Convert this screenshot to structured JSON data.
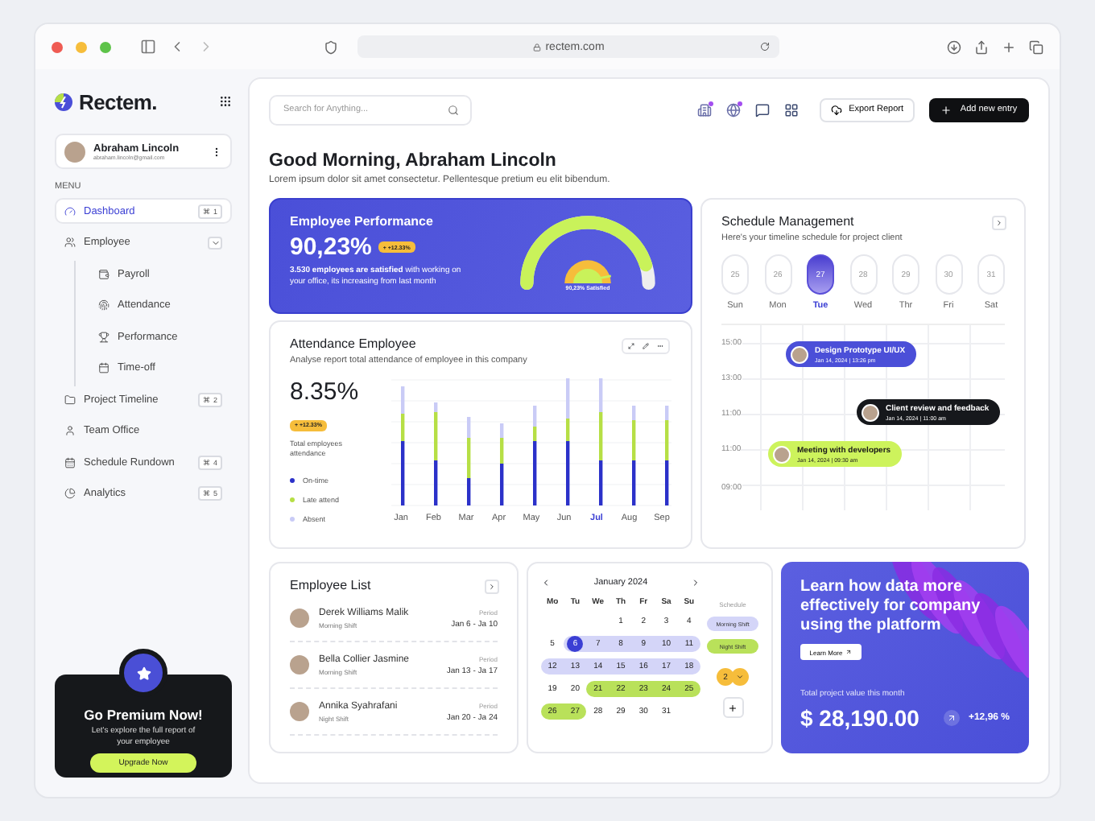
{
  "browser": {
    "url": "rectem.com"
  },
  "sidebar": {
    "logo": "Rectem.",
    "user": {
      "name": "Abraham Lincoln",
      "email": "abraham.lincoln@gmail.com"
    },
    "menu_label": "MENU",
    "items": [
      {
        "label": "Dashboard",
        "kind": "dashboard",
        "shortcut": "⌘ 1",
        "selected": true
      },
      {
        "label": "Employee",
        "kind": "employee",
        "selected": false,
        "expanded": true,
        "children": [
          {
            "label": "Payroll",
            "kind": "payroll"
          },
          {
            "label": "Attendance",
            "kind": "attendance"
          },
          {
            "label": "Performance",
            "kind": "performance"
          },
          {
            "label": "Time-off",
            "kind": "timeoff"
          }
        ]
      },
      {
        "label": "Project Timeline",
        "kind": "project",
        "shortcut": "⌘ 2",
        "selected": false
      },
      {
        "label": "Team Office",
        "kind": "team",
        "selected": false
      },
      {
        "label": "Schedule Rundown",
        "kind": "schedule",
        "shortcut": "⌘ 4",
        "selected": false
      },
      {
        "label": "Analytics",
        "kind": "analytics",
        "shortcut": "⌘ 5",
        "selected": false
      }
    ],
    "premium": {
      "title": "Go Premium Now!",
      "text": "Let's explore the full report of your employee",
      "button": "Upgrade Now"
    }
  },
  "header": {
    "search": {
      "placeholder": "Search for Anything..."
    },
    "export": "Export Report",
    "add": "Add new entry"
  },
  "greeting": {
    "title": "Good Morning, Abraham Lincoln",
    "subtitle": "Lorem ipsum dolor sit amet consectetur. Pellentesque pretium eu elit bibendum."
  },
  "performance": {
    "title": "Employee Performance",
    "value": "90,23%",
    "badge": "+ +12.33%",
    "text": "**3.530 employees are satisfied** with working on your office, its increasing from last month",
    "gauge": {
      "level": 0.9023,
      "label": "90,23% Satisfied"
    }
  },
  "attendance": {
    "title": "Attendance Employee",
    "subtitle": "Analyse report total attendance of employee in this company",
    "value": "8.35%",
    "badge": "+ +12.33%",
    "caption": "Total employees attendance",
    "legend": [
      {
        "label": "On-time",
        "color": "#2b31c9"
      },
      {
        "label": "Late attend",
        "color": "#b6df45"
      },
      {
        "label": "Absent",
        "color": "#c9cbf6"
      }
    ],
    "months": [
      {
        "label": "Jan",
        "selected": false
      },
      {
        "label": "Feb",
        "selected": false
      },
      {
        "label": "Mar",
        "selected": false
      },
      {
        "label": "Apr",
        "selected": false
      },
      {
        "label": "May",
        "selected": false
      },
      {
        "label": "Jun",
        "selected": false
      },
      {
        "label": "Jul",
        "selected": true
      },
      {
        "label": "Aug",
        "selected": false
      },
      {
        "label": "Sep",
        "selected": false
      }
    ]
  },
  "schedule": {
    "title": "Schedule Management",
    "subtitle": "Here's your timeline schedule for project client",
    "days": [
      {
        "date": "25",
        "weekday": "Sun",
        "selected": false
      },
      {
        "date": "26",
        "weekday": "Mon",
        "selected": false
      },
      {
        "date": "27",
        "weekday": "Tue",
        "selected": true
      },
      {
        "date": "28",
        "weekday": "Wed",
        "selected": false
      },
      {
        "date": "29",
        "weekday": "Thr",
        "selected": false
      },
      {
        "date": "30",
        "weekday": "Fri",
        "selected": false
      },
      {
        "date": "31",
        "weekday": "Sat",
        "selected": false
      }
    ],
    "times": [
      "15:00",
      "13:00",
      "11:00",
      "11:00",
      "09:00"
    ],
    "events": [
      {
        "title": "Design Prototype UI/UX",
        "time": "Jan 14, 2024 | 13:26 pm",
        "color": "#4b4fd8"
      },
      {
        "title": "Client review and feedback",
        "time": "Jan 14, 2024 | 11:00 am",
        "color": "#16181c"
      },
      {
        "title": "Meeting with developers",
        "time": "Jan 14, 2024 | 09:30 am",
        "color": "#cdf35c"
      }
    ]
  },
  "employees": {
    "title": "Employee List",
    "rows": [
      {
        "name": "Derek Williams Malik",
        "shift": "Morning Shift",
        "period_label": "Period",
        "period": "Jan 6 - Ja 10"
      },
      {
        "name": "Bella Collier Jasmine",
        "shift": "Morning Shift",
        "period_label": "Period",
        "period": "Jan 13 - Ja 17"
      },
      {
        "name": "Annika Syahrafani",
        "shift": "Night Shift",
        "period_label": "Period",
        "period": "Jan 20 - Ja 24"
      }
    ]
  },
  "calendar": {
    "month": "January 2024",
    "weekdays": [
      "Mo",
      "Tu",
      "We",
      "Th",
      "Fr",
      "Sa",
      "Su"
    ],
    "weeks": [
      [
        {
          "day": "1",
          "kind": "plain",
          "selected": false
        },
        {
          "day": "2",
          "kind": "plain",
          "selected": false
        },
        {
          "day": "3",
          "kind": "plain",
          "selected": false
        },
        {
          "day": "4",
          "kind": "plain",
          "selected": false
        }
      ],
      [
        {
          "day": "5",
          "kind": "plain",
          "selected": false
        },
        {
          "day": "6",
          "kind": "morning",
          "selected": true
        },
        {
          "day": "7",
          "kind": "morning",
          "selected": false
        },
        {
          "day": "8",
          "kind": "morning",
          "selected": false
        },
        {
          "day": "9",
          "kind": "morning",
          "selected": false
        },
        {
          "day": "10",
          "kind": "morning",
          "selected": false
        },
        {
          "day": "11",
          "kind": "morning",
          "selected": false
        }
      ],
      [
        {
          "day": "12",
          "kind": "morning",
          "selected": false
        },
        {
          "day": "13",
          "kind": "morning",
          "selected": false
        },
        {
          "day": "14",
          "kind": "morning",
          "selected": false
        },
        {
          "day": "15",
          "kind": "morning",
          "selected": false
        },
        {
          "day": "16",
          "kind": "morning",
          "selected": false
        },
        {
          "day": "17",
          "kind": "morning",
          "selected": false
        },
        {
          "day": "18",
          "kind": "morning",
          "selected": false
        }
      ],
      [
        {
          "day": "19",
          "kind": "plain",
          "selected": false
        },
        {
          "day": "20",
          "kind": "plain",
          "selected": false
        },
        {
          "day": "21",
          "kind": "night",
          "selected": false
        },
        {
          "day": "22",
          "kind": "night",
          "selected": false
        },
        {
          "day": "23",
          "kind": "night",
          "selected": false
        },
        {
          "day": "24",
          "kind": "night",
          "selected": false
        },
        {
          "day": "25",
          "kind": "night",
          "selected": false
        }
      ],
      [
        {
          "day": "26",
          "kind": "night",
          "selected": false
        },
        {
          "day": "27",
          "kind": "night",
          "selected": false
        },
        {
          "day": "28",
          "kind": "plain",
          "selected": false
        },
        {
          "day": "29",
          "kind": "plain",
          "selected": false
        },
        {
          "day": "30",
          "kind": "plain",
          "selected": false
        },
        {
          "day": "31",
          "kind": "plain",
          "selected": false
        }
      ]
    ],
    "legend_title": "Schedule",
    "legend": [
      {
        "label": "Morning Shift",
        "kind": "morning"
      },
      {
        "label": "Night Shift",
        "kind": "night"
      }
    ],
    "count": "2"
  },
  "promo": {
    "title": "Learn how data more effectively for company using the platform",
    "button": "Learn More",
    "caption": "Total project value this month",
    "value": "$ 28,190.00",
    "change": "+12,96 %"
  }
}
